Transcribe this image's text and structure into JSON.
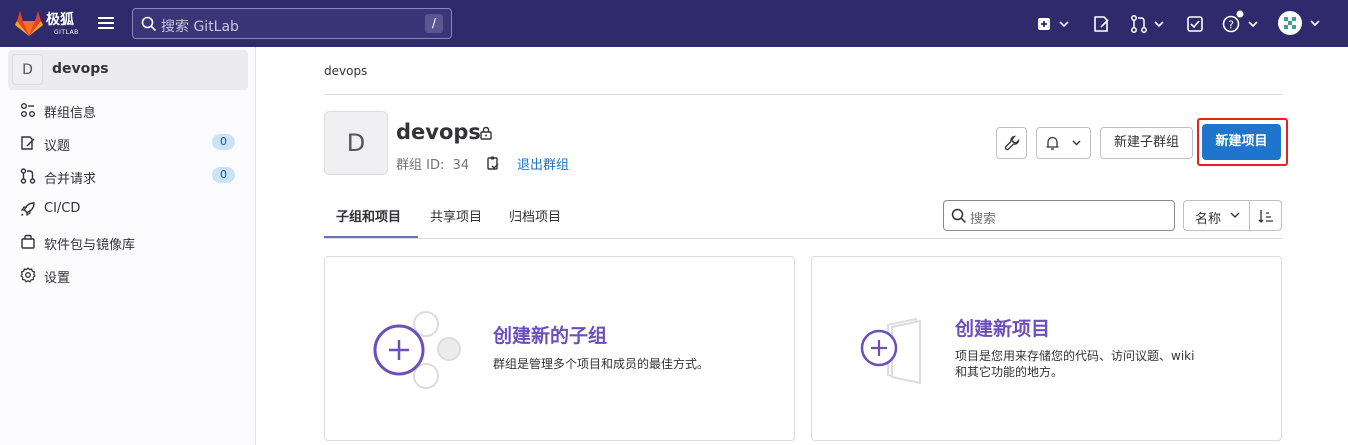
{
  "app": {
    "logo_text": "极狐",
    "logo_subtext": "GITLAB",
    "search_placeholder": "搜索 GitLab",
    "search_shortcut": "/"
  },
  "sidebar": {
    "context": {
      "avatar_letter": "D",
      "name": "devops"
    },
    "items": [
      {
        "label": "群组信息",
        "icon": "group-info-icon"
      },
      {
        "label": "议题",
        "icon": "issues-icon",
        "count": "0"
      },
      {
        "label": "合并请求",
        "icon": "merge-request-icon",
        "count": "0"
      },
      {
        "label": "CI/CD",
        "icon": "rocket-icon"
      },
      {
        "label": "软件包与镜像库",
        "icon": "package-icon"
      },
      {
        "label": "设置",
        "icon": "gear-icon"
      }
    ]
  },
  "breadcrumb": "devops",
  "group": {
    "avatar_letter": "D",
    "name": "devops",
    "id_label": "群组 ID:",
    "id_value": "34",
    "leave_label": "退出群组"
  },
  "actions": {
    "new_subgroup": "新建子群组",
    "new_project": "新建项目"
  },
  "tabs": [
    {
      "label": "子组和项目",
      "active": true
    },
    {
      "label": "共享项目",
      "active": false
    },
    {
      "label": "归档项目",
      "active": false
    }
  ],
  "filter": {
    "search_placeholder": "搜索",
    "sort_label": "名称"
  },
  "cards": [
    {
      "title": "创建新的子组",
      "description": "群组是管理多个项目和成员的最佳方式。"
    },
    {
      "title": "创建新项目",
      "description_line1": "项目是您用来存储您的代码、访问议题、wiki",
      "description_line2": "和其它功能的地方。"
    }
  ],
  "colors": {
    "topbar": "#2f2a6b",
    "primary": "#1f75cb",
    "accent_purple": "#6b4fbb",
    "highlight": "#e5231e"
  }
}
